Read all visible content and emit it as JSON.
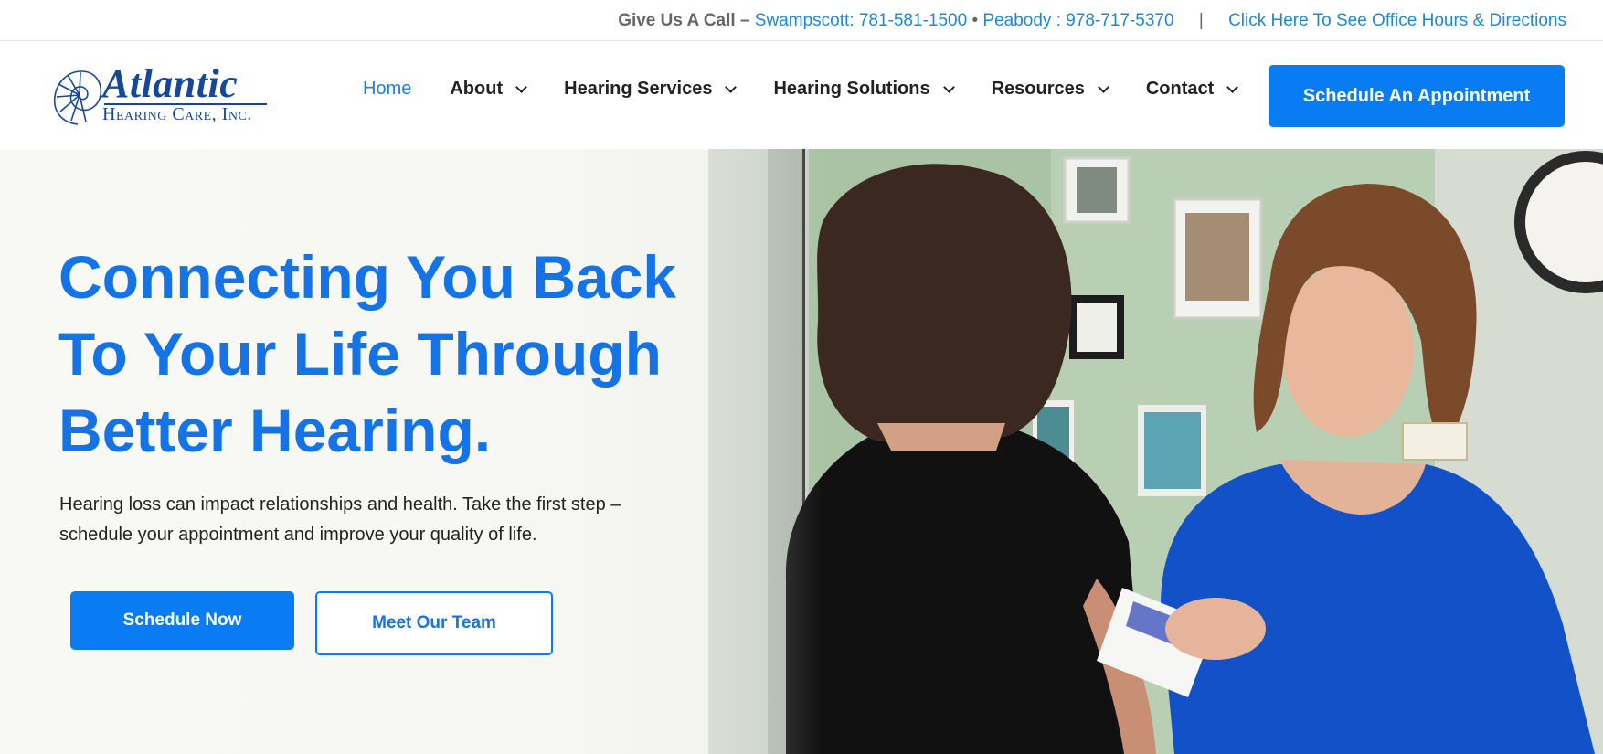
{
  "topbar": {
    "lead": "Give Us A Call –",
    "swampscott": "Swampscott: 781-581-1500",
    "bullet": "•",
    "peabody": "Peabody : 978-717-5370",
    "pipe": "|",
    "hours_link": "Click Here To See Office Hours & Directions"
  },
  "logo": {
    "word": "Atlantic",
    "sub": "Hearing Care, Inc."
  },
  "nav": {
    "items": [
      {
        "label": "Home",
        "has_dropdown": false,
        "active": true
      },
      {
        "label": "About",
        "has_dropdown": true,
        "active": false
      },
      {
        "label": "Hearing Services",
        "has_dropdown": true,
        "active": false
      },
      {
        "label": "Hearing Solutions",
        "has_dropdown": true,
        "active": false
      },
      {
        "label": "Resources",
        "has_dropdown": true,
        "active": false
      },
      {
        "label": "Contact",
        "has_dropdown": true,
        "active": false
      }
    ],
    "cta": "Schedule An Appointment"
  },
  "hero": {
    "headline": "Connecting You Back To Your Life Through Better Hearing.",
    "subcopy": "Hearing loss can impact relationships and health. Take the first step – schedule your appointment and improve your quality of life.",
    "primary_button": "Schedule Now",
    "secondary_button": "Meet Our Team"
  },
  "colors": {
    "brand_blue": "#0a7cf3",
    "headline_blue": "#1473e6",
    "logo_navy": "#16489a",
    "link_blue": "#1e88d8"
  },
  "icons": {
    "logo_mark": "nautilus-shell-icon",
    "dropdown": "chevron-down-icon"
  }
}
